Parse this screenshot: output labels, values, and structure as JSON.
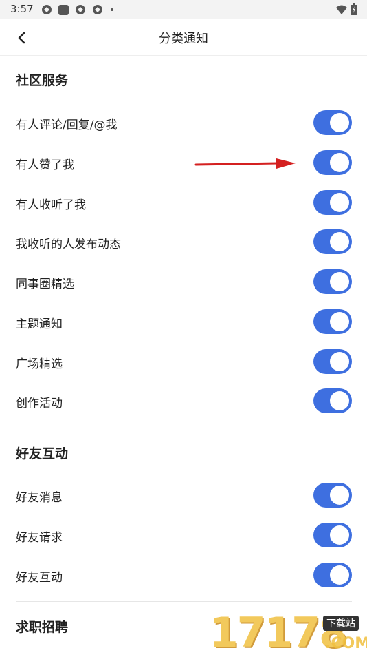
{
  "status_bar": {
    "time": "3:57"
  },
  "header": {
    "title": "分类通知"
  },
  "sections": [
    {
      "title": "社区服务",
      "items": [
        {
          "label": "有人评论/回复/@我",
          "on": true
        },
        {
          "label": "有人赞了我",
          "on": true
        },
        {
          "label": "有人收听了我",
          "on": true
        },
        {
          "label": "我收听的人发布动态",
          "on": true
        },
        {
          "label": "同事圈精选",
          "on": true
        },
        {
          "label": "主题通知",
          "on": true
        },
        {
          "label": "广场精选",
          "on": true
        },
        {
          "label": "创作活动",
          "on": true
        }
      ]
    },
    {
      "title": "好友互动",
      "items": [
        {
          "label": "好友消息",
          "on": true
        },
        {
          "label": "好友请求",
          "on": true
        },
        {
          "label": "好友互动",
          "on": true
        }
      ]
    },
    {
      "title": "求职招聘",
      "items": []
    }
  ],
  "watermark": {
    "text": "17178",
    "badge": "下载站",
    "suffix": ".COM"
  },
  "colors": {
    "toggle_on": "#3e6fe0",
    "annotation_arrow": "#d42020"
  }
}
